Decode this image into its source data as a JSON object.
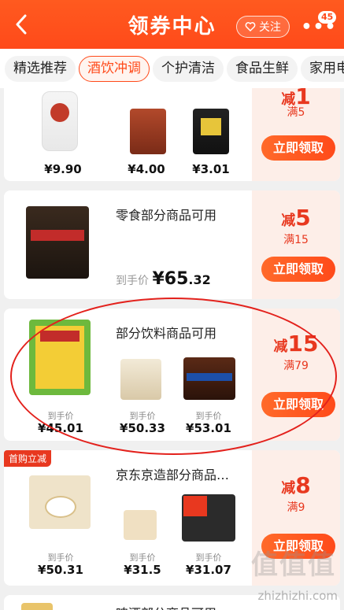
{
  "header": {
    "title": "领券中心",
    "follow_label": "关注",
    "more_badge": "45"
  },
  "tabs": [
    {
      "label": "精选推荐"
    },
    {
      "label": "酒饮冲调"
    },
    {
      "label": "个护清洁"
    },
    {
      "label": "食品生鲜"
    },
    {
      "label": "家用电"
    }
  ],
  "cards": [
    {
      "coupon": {
        "reduce_label": "减",
        "amount": "1",
        "condition": "满5",
        "button": "立即领取"
      },
      "prices": [
        "¥9.90",
        "¥4.00",
        "¥3.01"
      ]
    },
    {
      "title": "零食部分商品可用",
      "coupon": {
        "reduce_label": "减",
        "amount": "5",
        "condition": "满15",
        "button": "立即领取"
      },
      "price_label": "到手价",
      "price_int": "¥65",
      "price_dec": ".32"
    },
    {
      "title": "部分饮料商品可用",
      "coupon": {
        "reduce_label": "减",
        "amount": "15",
        "condition": "满79",
        "button": "立即领取"
      },
      "items": [
        {
          "label": "到手价",
          "price": "¥45.01"
        },
        {
          "label": "到手价",
          "price": "¥50.33"
        },
        {
          "label": "到手价",
          "price": "¥53.01"
        }
      ]
    },
    {
      "tag": "首购立减",
      "title": "京东京造部分商品…",
      "coupon": {
        "reduce_label": "减",
        "amount": "8",
        "condition": "满9",
        "button": "立即领取"
      },
      "items": [
        {
          "label": "到手价",
          "price": "¥50.31"
        },
        {
          "label": "到手价",
          "price": "¥31.5"
        },
        {
          "label": "到手价",
          "price": "¥31.07"
        }
      ]
    },
    {
      "title": "啤酒部分商品可用"
    }
  ],
  "watermark": "值值值",
  "watermark_sub": "zhizhizhi.com"
}
